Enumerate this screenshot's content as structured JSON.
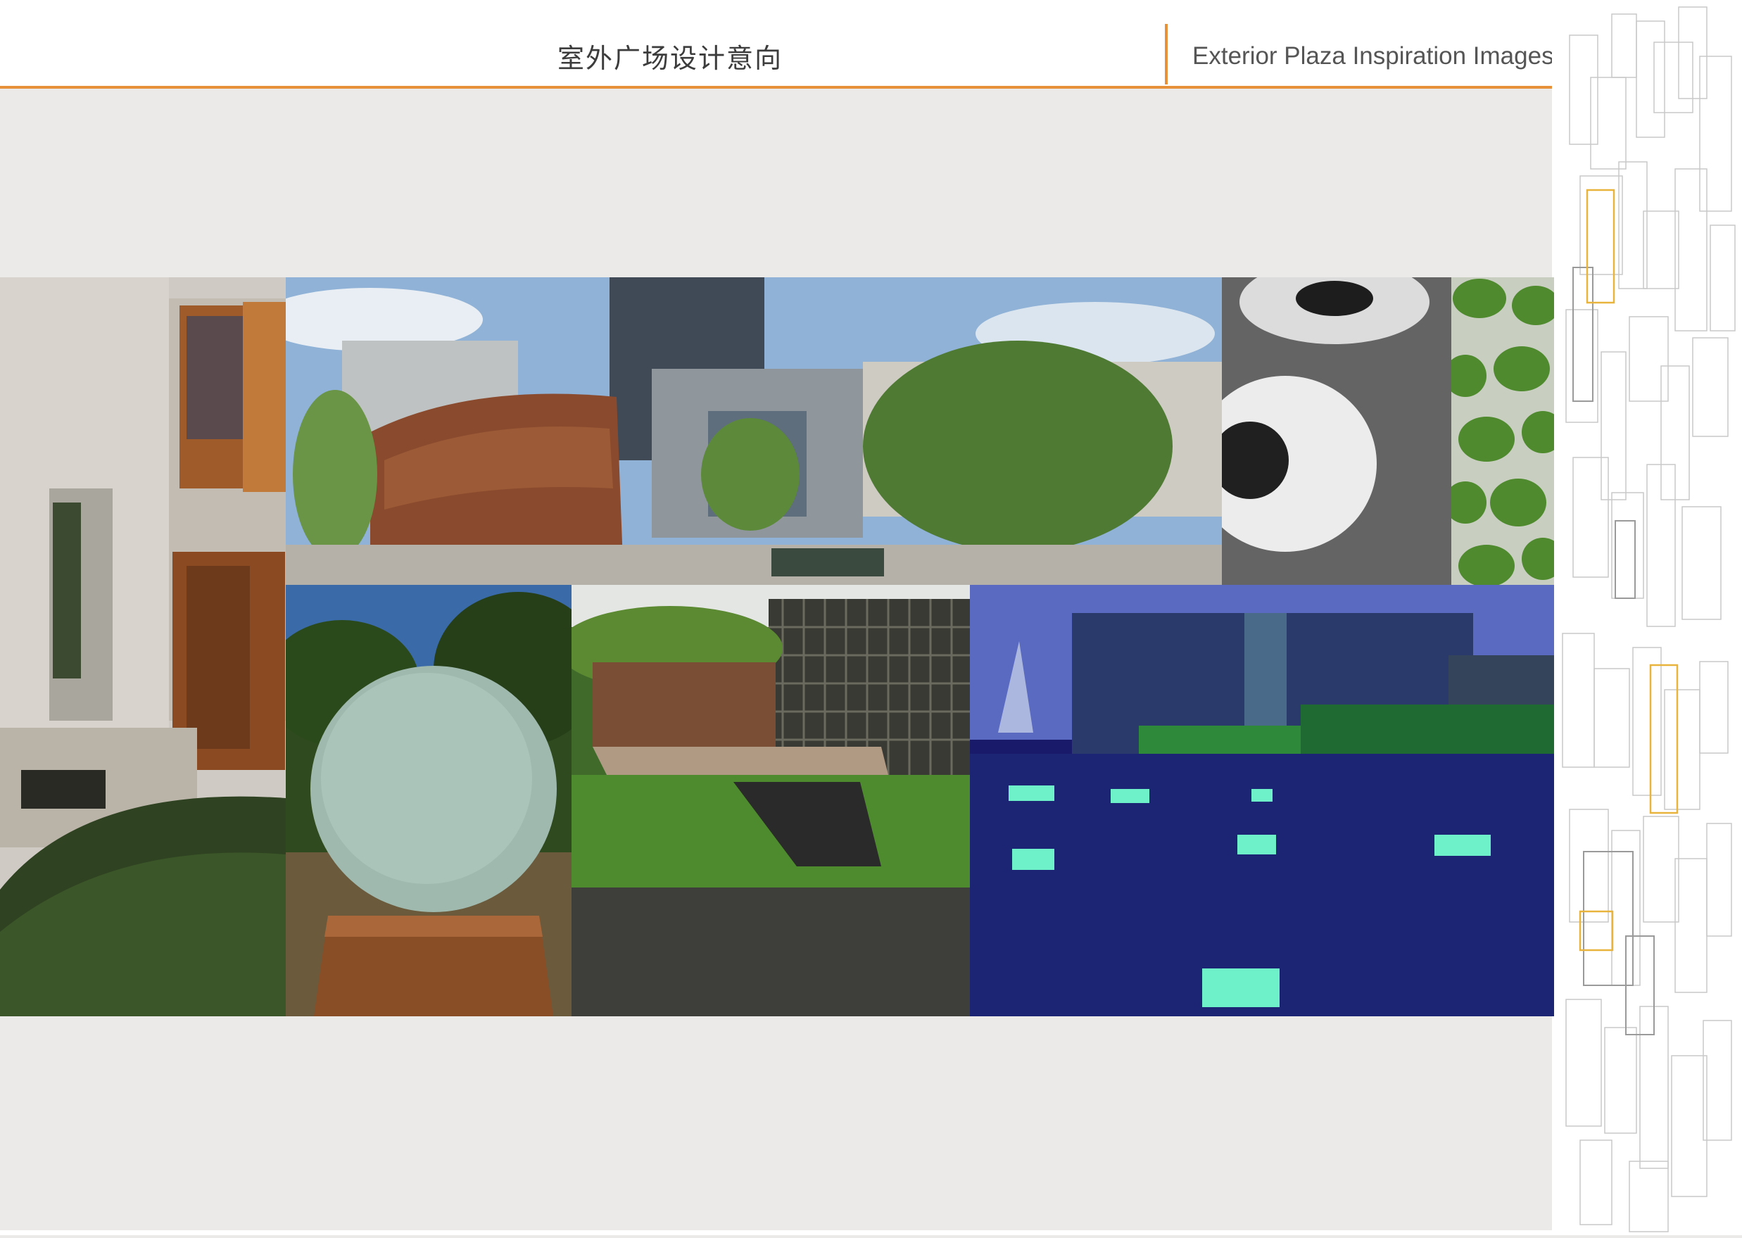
{
  "header": {
    "title_cn": "室外广场设计意向",
    "title_en": "Exterior Plaza Inspiration Images"
  },
  "colors": {
    "accent": "#e7913b",
    "ornament_gold": "#e9b43c",
    "background": "#ebeae8",
    "panel": "#ffffff"
  },
  "images": [
    {
      "name": "concrete-courtyard-photo",
      "icon": "building-photo"
    },
    {
      "name": "panorama-plaza-photo",
      "icon": "plaza-photo"
    },
    {
      "name": "stone-ring-detail-photo",
      "icon": "pebble-ring-photo"
    },
    {
      "name": "grass-paver-photo",
      "icon": "grass-photo"
    },
    {
      "name": "glass-sphere-sculpture-photo",
      "icon": "sphere-photo"
    },
    {
      "name": "garden-deck-photo",
      "icon": "garden-photo"
    },
    {
      "name": "night-rooftop-plaza-photo",
      "icon": "night-plaza-photo"
    }
  ]
}
